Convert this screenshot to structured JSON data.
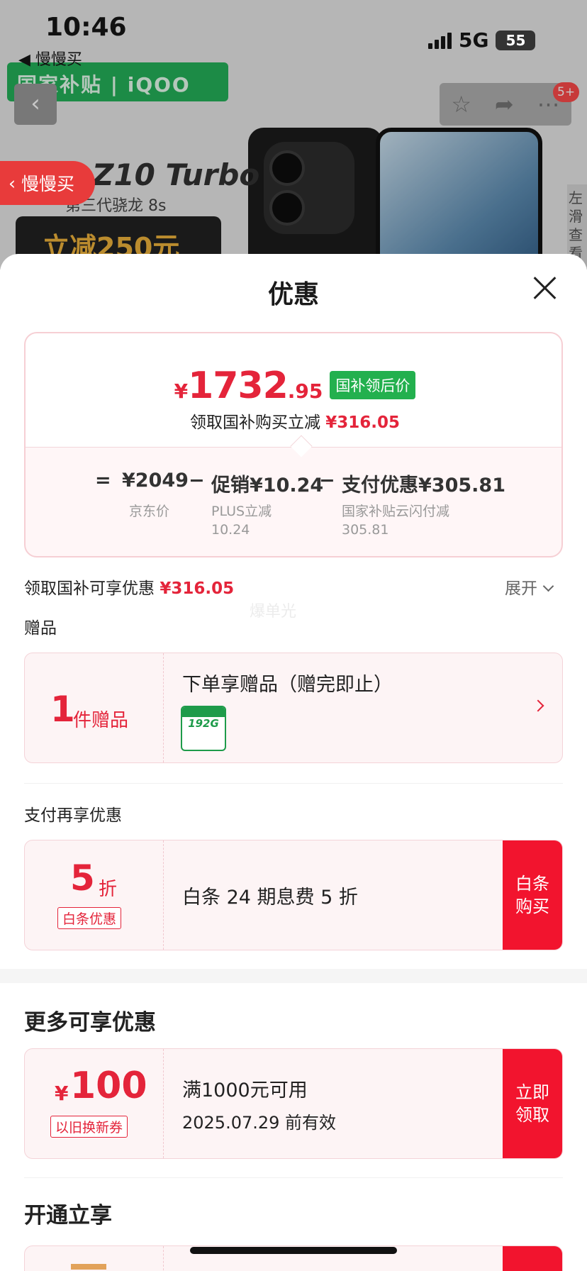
{
  "status_bar": {
    "time": "10:46",
    "back_app": "◀ 慢慢买",
    "network": "5G",
    "battery": "55"
  },
  "background": {
    "brand_banner": "国家补贴 | iQOO",
    "product_name": "Z10 Turbo",
    "product_sub": "第三代骁龙 8s",
    "promo_pill": "立减250元",
    "badge": "5+",
    "side_text": "左滑查看",
    "back_tab_label": "慢慢买"
  },
  "sheet": {
    "title": "优惠",
    "price": {
      "currency": "¥",
      "integer": "1732",
      "decimal": ".95",
      "tag": "国补领后价"
    },
    "saving_line": {
      "label": "领取国补购买立减",
      "amount": "¥316.05"
    },
    "calc": {
      "eq": "=",
      "minus": "−",
      "base": "¥2049",
      "base_label": "京东价",
      "promo": "促销¥10.24",
      "promo_label_1": "PLUS立减",
      "promo_label_2": "10.24",
      "pay": "支付优惠¥305.81",
      "pay_label_1": "国家补贴云闪付减",
      "pay_label_2": "305.81"
    },
    "gov_line": {
      "label": "领取国补可享优惠",
      "amount": "¥316.05",
      "expand": "展开"
    },
    "watermark": "爆单光",
    "gifts": {
      "section": "赠品",
      "count": "1",
      "unit": "件赠品",
      "title": "下单享赠品（赠完即止）",
      "sim_text": "192G"
    },
    "pay_extra": {
      "section": "支付再享优惠",
      "value": "5",
      "unit": "折",
      "tag": "白条优惠",
      "desc": "白条 24 期息费 5 折",
      "button": "白条购买"
    },
    "more": {
      "section": "更多可享优惠",
      "currency": "¥",
      "amount": "100",
      "tag": "以旧换新券",
      "condition": "满1000元可用",
      "expiry": "2025.07.29 前有效",
      "button": "立即领取"
    },
    "open_section": "开通立享"
  }
}
